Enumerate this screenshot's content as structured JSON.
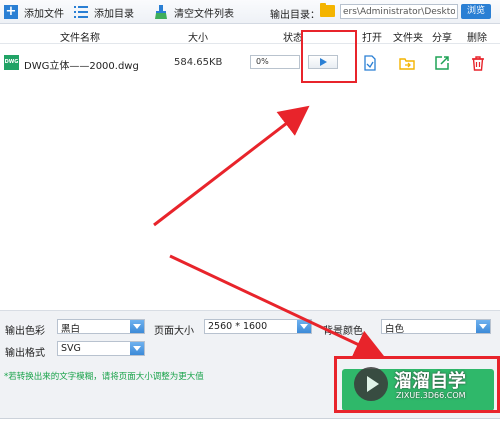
{
  "toolbar": {
    "add_file": "添加文件",
    "add_dir": "添加目录",
    "clear_list": "清空文件列表",
    "output_dir_label": "输出目录：",
    "output_dir_value": "ers\\Administrator\\Desktop",
    "browse": "浏览"
  },
  "columns": {
    "name": "文件名称",
    "size": "大小",
    "status": "状态",
    "open": "打开",
    "folder": "文件夹",
    "share": "分享",
    "delete": "删除"
  },
  "file": {
    "icon_text": "DWG",
    "name": "DWG立体——2000.dwg",
    "size": "584.65KB",
    "progress_text": "0%",
    "progress_value": 0
  },
  "settings": {
    "output_color_label": "输出色彩",
    "output_color_value": "黑白",
    "page_size_label": "页面大小",
    "page_size_value": "2560 * 1600",
    "bg_color_label": "背景颜色",
    "bg_color_value": "白色",
    "output_format_label": "输出格式",
    "output_format_value": "SVG"
  },
  "footer": {
    "hint": "*若转换出来的文字模糊，请将页面大小调整为更大值"
  },
  "watermark": {
    "title": "溜溜自学",
    "subtitle": "ZIXUE.3D66.COM"
  },
  "colors": {
    "accent": "#2a7fd4",
    "highlight": "#e8242b",
    "convert": "#2fb86a",
    "hint": "#19a34a"
  },
  "icons": {
    "add_file": "plus-icon",
    "add_dir": "list-icon",
    "clear_list": "broom-icon",
    "output_dir": "folder-icon",
    "play": "play-icon",
    "open": "document-icon",
    "folder": "folder-arrow-icon",
    "share": "share-icon",
    "delete": "trash-icon"
  }
}
